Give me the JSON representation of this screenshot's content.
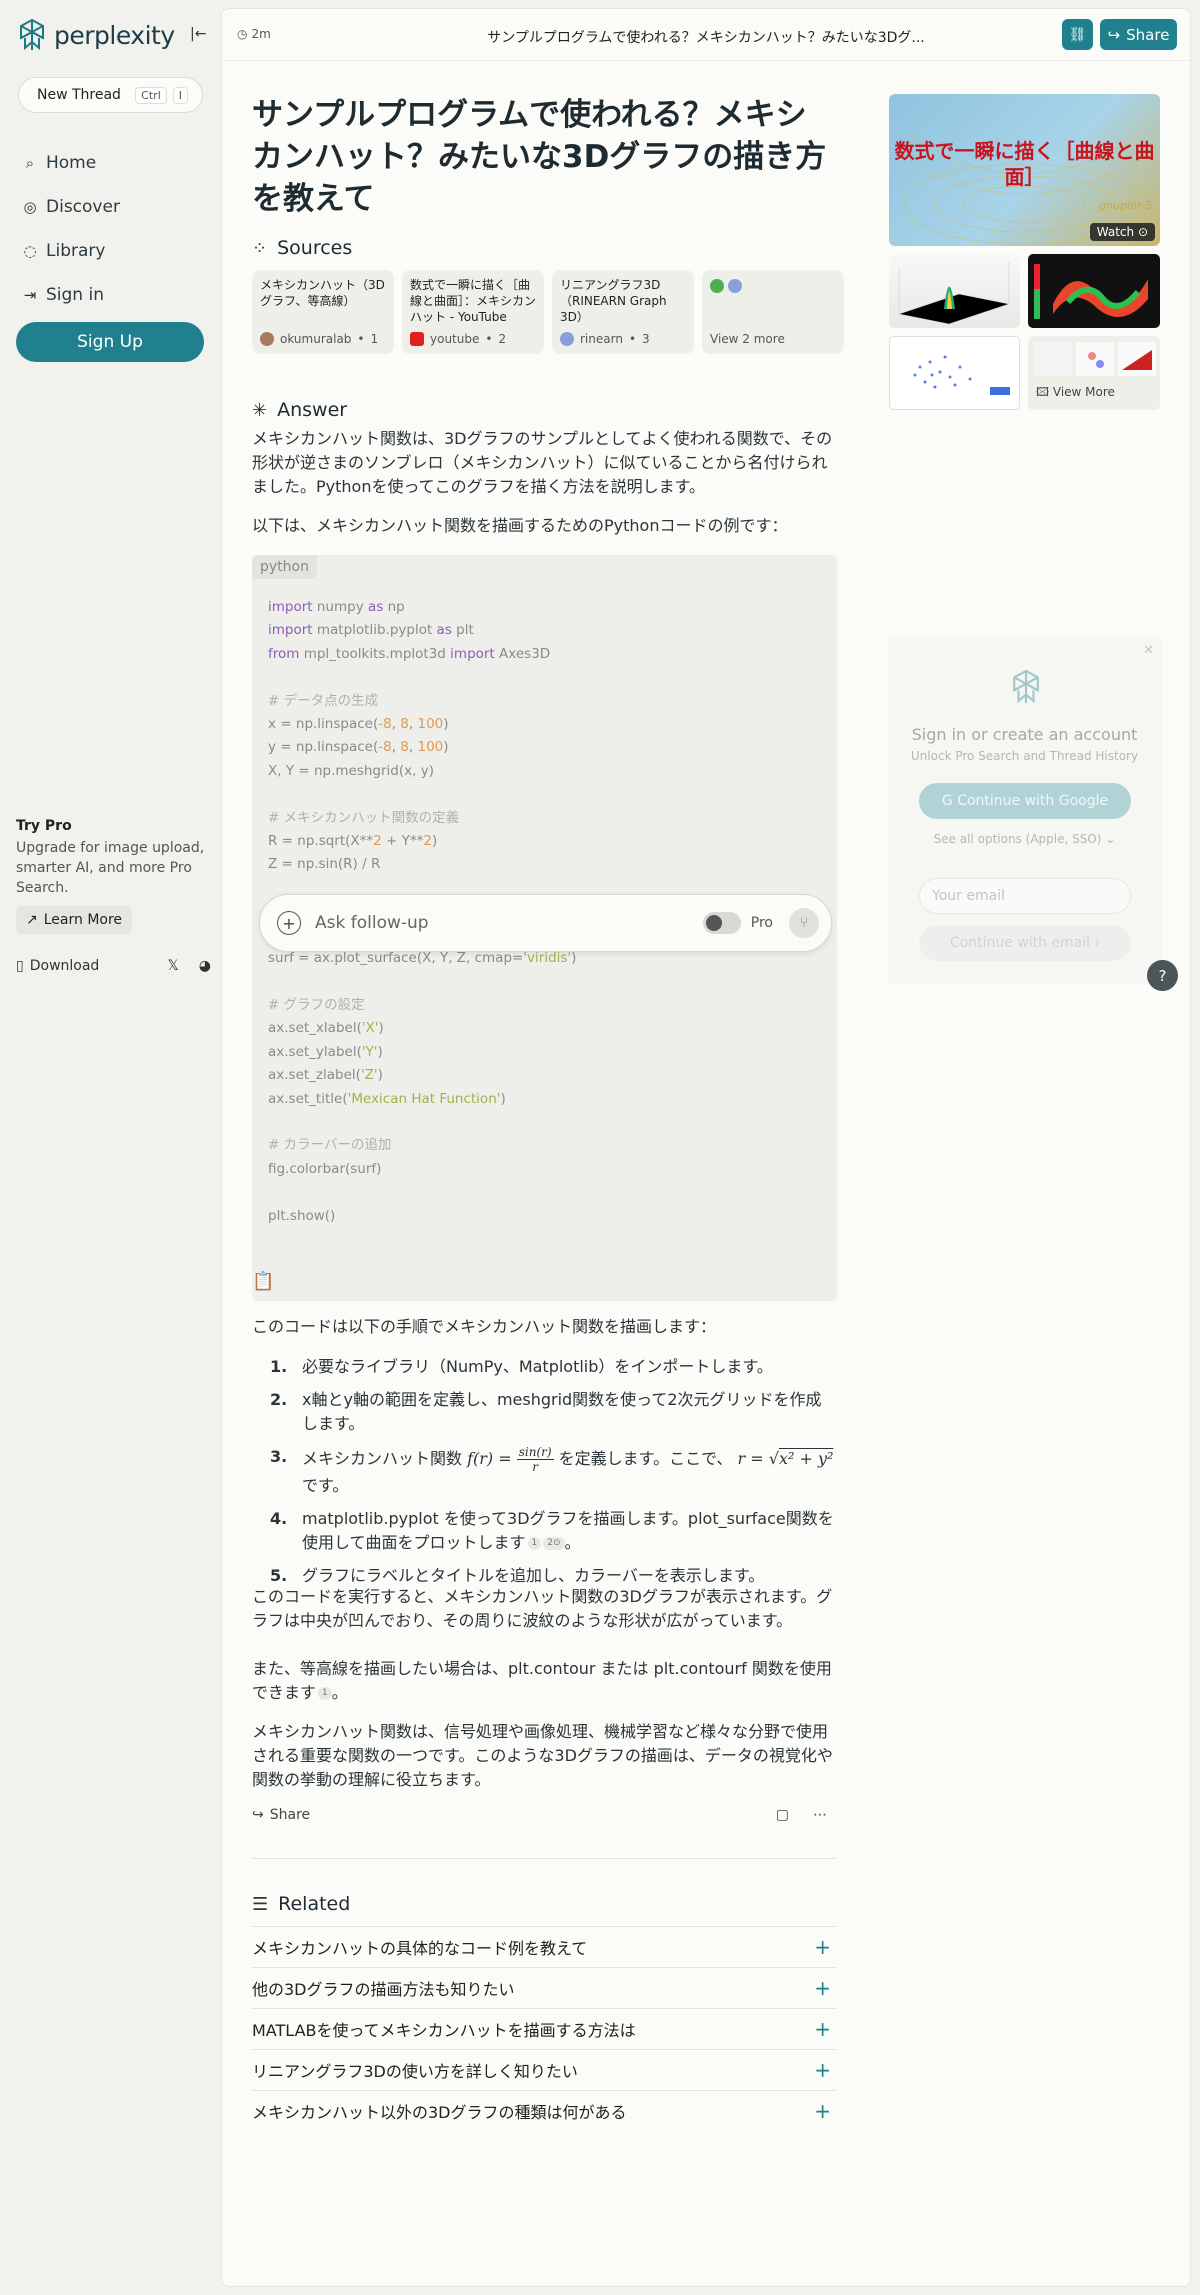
{
  "app": {
    "name": "perplexity"
  },
  "sidebar": {
    "new_thread": "New Thread",
    "kbd": [
      "Ctrl",
      "I"
    ],
    "items": [
      {
        "label": "Home",
        "icon": "home-icon"
      },
      {
        "label": "Discover",
        "icon": "globe-icon"
      },
      {
        "label": "Library",
        "icon": "library-icon"
      },
      {
        "label": "Sign in",
        "icon": "sign-in-icon"
      }
    ],
    "signup": "Sign Up",
    "trypro": {
      "title": "Try Pro",
      "desc": "Upgrade for image upload, smarter AI, and more Pro Search.",
      "learn": "Learn More"
    },
    "download": "Download"
  },
  "header": {
    "time": "2m",
    "title": "サンプルプログラムで使われる？メキシカンハット？みたいな3Dグ...",
    "share": "Share"
  },
  "question": "サンプルプログラムで使われる？メキシカンハット？みたいな3Dグラフの描き方を教えて",
  "sources": {
    "heading": "Sources",
    "items": [
      {
        "title": "メキシカンハット（3Dグラフ、等高線）",
        "site": "okumuralab",
        "num": "1",
        "fav_color": "#a57a5f"
      },
      {
        "title": "数式で一瞬に描く［曲線と曲面］：メキシカンハット - YouTube",
        "site": "youtube",
        "num": "2",
        "fav_color": "#e02020"
      },
      {
        "title": "リニアングラフ3D（RINEARN Graph 3D）",
        "site": "rinearn",
        "num": "3",
        "fav_color": "#8a9fd8"
      }
    ],
    "more": "View 2 more"
  },
  "answer": {
    "heading": "Answer",
    "intro": "メキシカンハット関数は、3Dグラフのサンプルとしてよく使われる関数で、その形状が逆さまのソンブレロ（メキシカンハット）に似ていることから名付けられました。Pythonを使ってこのグラフを描く方法を説明します。",
    "code_intro": "以下は、メキシカンハット関数を描画するためのPythonコードの例です：",
    "code_lang": "python",
    "steps_intro": "このコードは以下の手順でメキシカンハット関数を描画します：",
    "steps": {
      "s1": "必要なライブラリ（NumPy、Matplotlib）をインポートします。",
      "s2": "x軸とy軸の範囲を定義し、meshgrid関数を使って2次元グリッドを作成します。",
      "s3a": "メキシカンハット関数",
      "s3b": "を定義します。ここで、",
      "s3c": "です。",
      "s4": "matplotlib.pyplot を使って3Dグラフを描画します。plot_surface関数を使用して曲面をプロットします",
      "s5": "グラフにラベルとタイトルを追加し、カラーバーを表示します。"
    },
    "math": {
      "f": "f(r) =",
      "num": "sin(r)",
      "den": "r",
      "r": "r =",
      "rad": "x² + y²"
    },
    "p1": "このコードを実行すると、メキシカンハット関数の3Dグラフが表示されます。グラフは中央が凹んでおり、その周りに波紋のような形状が広がっています。",
    "p2": "また、等高線を描画したい場合は、plt.contour または plt.contourf 関数を使用できます",
    "p3": "メキシカンハット関数は、信号処理や画像処理、機械学習など様々な分野で使用される重要な関数の一つです。このような3Dグラフの描画は、データの視覚化や関数の挙動の理解に役立ちます。",
    "share": "Share"
  },
  "followup": {
    "placeholder": "Ask follow-up",
    "pro": "Pro"
  },
  "related": {
    "heading": "Related",
    "items": [
      "メキシカンハットの具体的なコード例を教えて",
      "他の3Dグラフの描画方法も知りたい",
      "MATLABを使ってメキシカンハットを描画する方法は",
      "リニアングラフ3Dの使い方を詳しく知りたい",
      "メキシカンハット以外の3Dグラフの種類は何がある"
    ]
  },
  "media": {
    "video_title": "数式で一瞬に描く［曲線と曲面］",
    "video_sub": "gnuplot-5",
    "watch": "Watch",
    "view_more": "View More"
  },
  "signin": {
    "title": "Sign in or create an account",
    "subtitle": "Unlock Pro Search and Thread History",
    "google": "Continue with Google",
    "other": "See all options (Apple, SSO)",
    "email_placeholder": "Your email",
    "continue_email": "Continue with email"
  },
  "help": "?"
}
